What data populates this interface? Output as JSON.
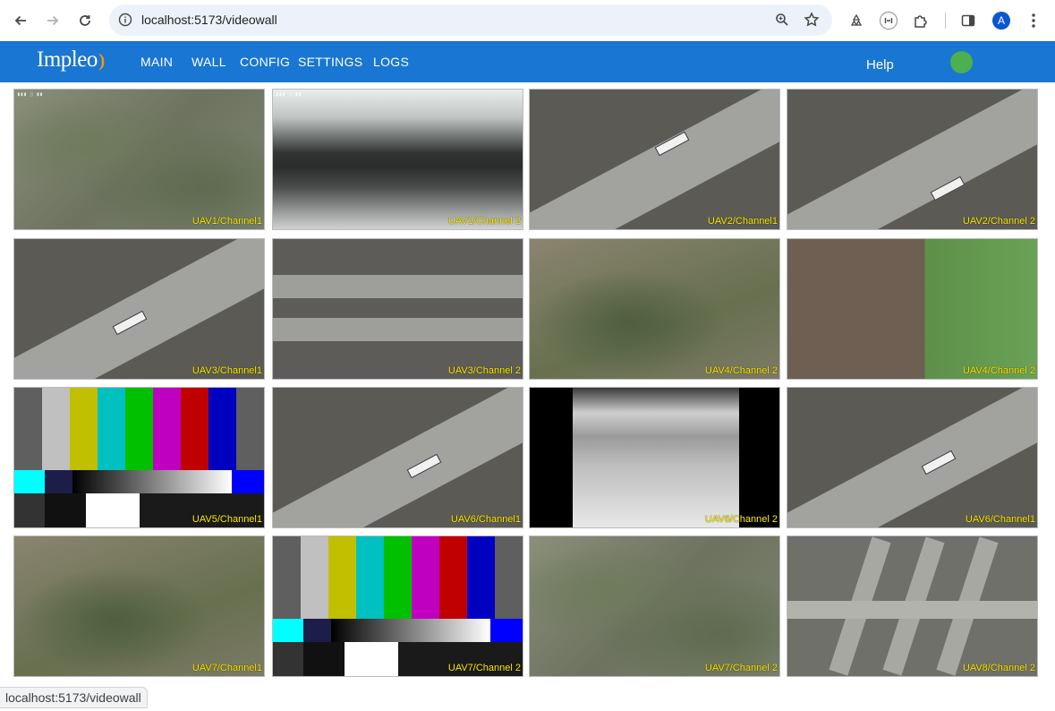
{
  "browser": {
    "url": "localhost:5173/videowall",
    "avatar_letter": "A"
  },
  "app": {
    "logo": "Impleo",
    "nav": [
      "MAIN",
      "WALL",
      "CONFIG",
      "SETTINGS",
      "LOGS"
    ],
    "help": "Help",
    "status_color": "#4caf50",
    "accent": "#1976d2"
  },
  "wall": {
    "tiles": [
      {
        "label": "UAV1/Channel1",
        "scene": "aerial"
      },
      {
        "label": "UAV1/Channel 2",
        "scene": "ir"
      },
      {
        "label": "UAV2/Channel1",
        "scene": "highway"
      },
      {
        "label": "UAV2/Channel 2",
        "scene": "highway"
      },
      {
        "label": "UAV3/Channel1",
        "scene": "highway"
      },
      {
        "label": "UAV3/Channel 2",
        "scene": "flat-road"
      },
      {
        "label": "UAV4/Channel 2",
        "scene": "aerial"
      },
      {
        "label": "UAV4/Channel 2",
        "scene": "fields"
      },
      {
        "label": "UAV5/Channel1",
        "scene": "color-bars"
      },
      {
        "label": "UAV6/Channel1",
        "scene": "highway"
      },
      {
        "label": "UAV6/Channel 2",
        "scene": "thermal"
      },
      {
        "label": "UAV6/Channel1",
        "scene": "highway"
      },
      {
        "label": "UAV7/Channel1",
        "scene": "aerial"
      },
      {
        "label": "UAV7/Channel 2",
        "scene": "color-bars"
      },
      {
        "label": "UAV7/Channel 2",
        "scene": "aerial"
      },
      {
        "label": "UAV8/Channel 2",
        "scene": "interchange"
      }
    ]
  },
  "statusbar": {
    "link": "localhost:5173/videowall"
  }
}
